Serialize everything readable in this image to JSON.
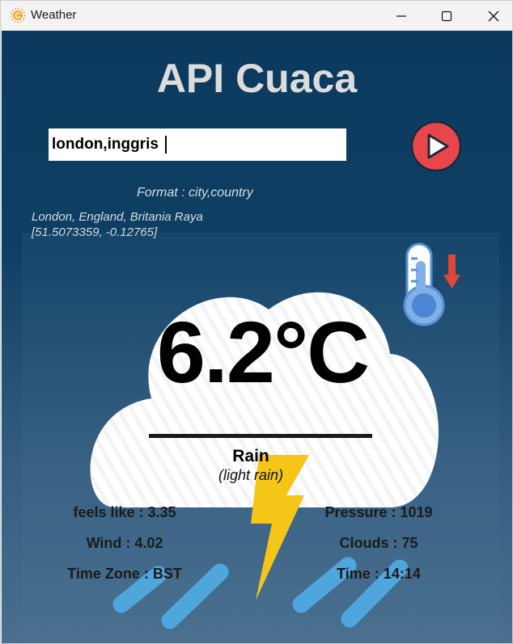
{
  "window": {
    "title": "Weather"
  },
  "app": {
    "heading": "API Cuaca"
  },
  "search": {
    "value": "london,inggris",
    "format_hint": "Format : city,country"
  },
  "location": {
    "name": "London, England, Britania Raya",
    "coordinates": "[51.5073359, -0.12765]"
  },
  "weather": {
    "temperature": "6.2°C",
    "main": "Rain",
    "description": "(light rain)"
  },
  "stats": {
    "feels_like": "feels like : 3.35",
    "wind": "Wind : 4.02",
    "time_zone": "Time Zone : BST",
    "pressure": "Pressure : 1019",
    "clouds": "Clouds : 75",
    "time": "Time : 14:14"
  },
  "icons": {
    "app": "sun-icon",
    "submit": "play-icon",
    "thermometer": "thermometer-down-icon",
    "cloud": "cloud-icon",
    "lightning": "lightning-bolt-icon",
    "rain": "rain-drops-icon"
  },
  "colors": {
    "background_top": "#0b3a5e",
    "heading": "#dcdcdc",
    "play_button": "#e8464b",
    "lightning": "#f5c518",
    "rain": "#4fa6dc",
    "thermometer": "#7fb0e6",
    "arrow": "#e0463c"
  }
}
